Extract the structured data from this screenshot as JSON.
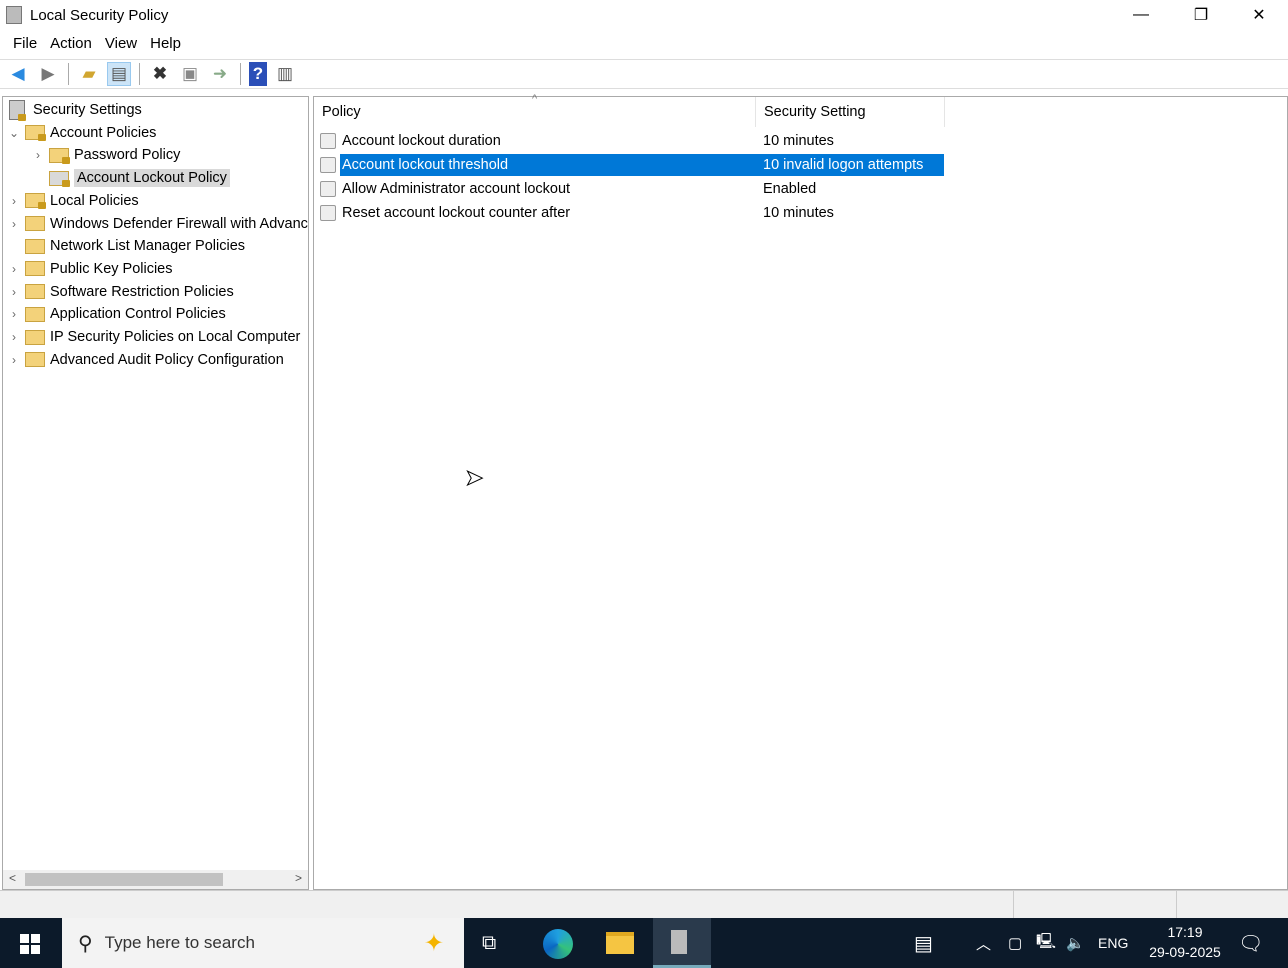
{
  "window": {
    "title": "Local Security Policy",
    "minimize": "—",
    "restore": "❐",
    "close": "✕"
  },
  "menu": [
    "File",
    "Action",
    "View",
    "Help"
  ],
  "toolbar": {
    "back": "back-icon",
    "forward": "forward-icon",
    "up": "up-folder-icon",
    "show_hide_tree": "console-tree-icon",
    "delete": "delete-icon",
    "properties": "properties-icon",
    "export": "export-list-icon",
    "help": "help-icon",
    "show_action_pane": "action-pane-icon"
  },
  "tree": [
    {
      "label": "Security Settings",
      "level": 0,
      "expander": ""
    },
    {
      "label": "Account Policies",
      "level": 1,
      "expander": "expanded"
    },
    {
      "label": "Password Policy",
      "level": 2,
      "expander": "collapsed"
    },
    {
      "label": "Account Lockout Policy",
      "level": 2,
      "expander": "",
      "selected": true
    },
    {
      "label": "Local Policies",
      "level": 1,
      "expander": "collapsed"
    },
    {
      "label": "Windows Defender Firewall with Advanced Security",
      "level": 1,
      "expander": "collapsed"
    },
    {
      "label": "Network List Manager Policies",
      "level": 1,
      "expander": ""
    },
    {
      "label": "Public Key Policies",
      "level": 1,
      "expander": "collapsed"
    },
    {
      "label": "Software Restriction Policies",
      "level": 1,
      "expander": "collapsed"
    },
    {
      "label": "Application Control Policies",
      "level": 1,
      "expander": "collapsed"
    },
    {
      "label": "IP Security Policies on Local Computer",
      "level": 1,
      "expander": "collapsed"
    },
    {
      "label": "Advanced Audit Policy Configuration",
      "level": 1,
      "expander": "collapsed"
    }
  ],
  "list": {
    "columns": [
      "Policy",
      "Security Setting"
    ],
    "rows": [
      {
        "policy": "Account lockout duration",
        "setting": "10 minutes"
      },
      {
        "policy": "Account lockout threshold",
        "setting": "10 invalid logon attempts",
        "selected": true
      },
      {
        "policy": "Allow Administrator account lockout",
        "setting": "Enabled"
      },
      {
        "policy": "Reset account lockout counter after",
        "setting": "10 minutes"
      }
    ]
  },
  "taskbar": {
    "search_placeholder": "Type here to search",
    "language": "ENG",
    "time": "17:19",
    "date": "29-09-2025"
  },
  "colors": {
    "selection": "#0078d7",
    "taskbar": "#0c1a2a"
  }
}
